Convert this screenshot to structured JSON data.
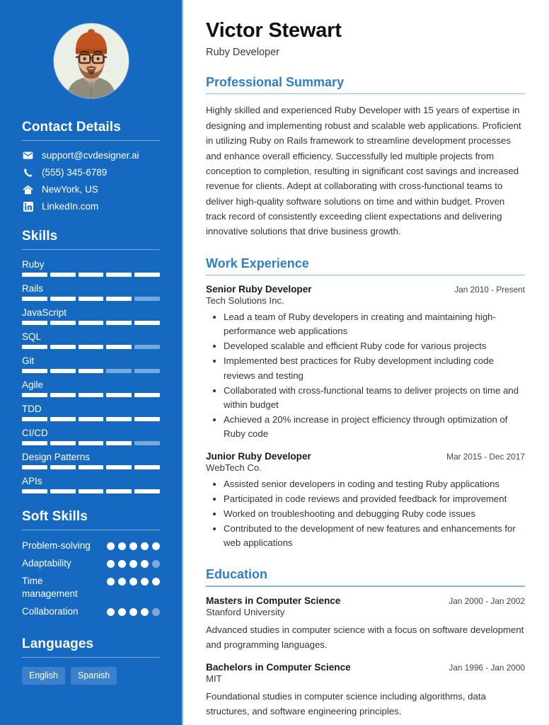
{
  "colors": {
    "sidebar_bg": "#1669c0",
    "accent": "#2f7fc4",
    "rule": "#87b6dd",
    "skill_off": "#76a7dd",
    "dot_off": "#7fa9d6",
    "badge_bg": "#3a80cb"
  },
  "sidebar": {
    "avatar": {
      "icon": "profile-photo",
      "alt": "Portrait of a man with an orange beanie, glasses and a beard"
    },
    "contact": {
      "heading": "Contact Details",
      "items": [
        {
          "icon": "envelope-icon",
          "label": "support@cvdesigner.ai"
        },
        {
          "icon": "phone-icon",
          "label": "(555) 345-6789"
        },
        {
          "icon": "home-icon",
          "label": "NewYork, US"
        },
        {
          "icon": "linkedin-icon",
          "label": "LinkedIn.com"
        }
      ]
    },
    "skills": {
      "heading": "Skills",
      "segments": 5,
      "items": [
        {
          "name": "Ruby",
          "filled": 5
        },
        {
          "name": "Rails",
          "filled": 4
        },
        {
          "name": "JavaScript",
          "filled": 5
        },
        {
          "name": "SQL",
          "filled": 4
        },
        {
          "name": "Git",
          "filled": 3
        },
        {
          "name": "Agile",
          "filled": 5
        },
        {
          "name": "TDD",
          "filled": 5
        },
        {
          "name": "CI/CD",
          "filled": 4
        },
        {
          "name": "Design Patterns",
          "filled": 5
        },
        {
          "name": "APIs",
          "filled": 5
        }
      ]
    },
    "soft_skills": {
      "heading": "Soft Skills",
      "dots_total": 5,
      "items": [
        {
          "name": "Problem-solving",
          "filled": 5
        },
        {
          "name": "Adaptability",
          "filled": 4
        },
        {
          "name": "Time management",
          "filled": 5
        },
        {
          "name": "Collaboration",
          "filled": 4
        }
      ]
    },
    "languages": {
      "heading": "Languages",
      "items": [
        "English",
        "Spanish"
      ]
    }
  },
  "main": {
    "name": "Victor Stewart",
    "job_title": "Ruby Developer",
    "summary": {
      "heading": "Professional Summary",
      "text": "Highly skilled and experienced Ruby Developer with 15 years of expertise in designing and implementing robust and scalable web applications. Proficient in utilizing Ruby on Rails framework to streamline development processes and enhance overall efficiency. Successfully led multiple projects from conception to completion, resulting in significant cost savings and increased revenue for clients. Adept at collaborating with cross-functional teams to deliver high-quality software solutions on time and within budget. Proven track record of consistently exceeding client expectations and delivering innovative solutions that drive business growth."
    },
    "experience": {
      "heading": "Work Experience",
      "entries": [
        {
          "title": "Senior Ruby Developer",
          "date": "Jan 2010 - Present",
          "org": "Tech Solutions Inc.",
          "bullets": [
            "Lead a team of Ruby developers in creating and maintaining high-performance web applications",
            "Developed scalable and efficient Ruby code for various projects",
            "Implemented best practices for Ruby development including code reviews and testing",
            "Collaborated with cross-functional teams to deliver projects on time and within budget",
            "Achieved a 20% increase in project efficiency through optimization of Ruby code"
          ]
        },
        {
          "title": "Junior Ruby Developer",
          "date": "Mar 2015 - Dec 2017",
          "org": "WebTech Co.",
          "bullets": [
            "Assisted senior developers in coding and testing Ruby applications",
            "Participated in code reviews and provided feedback for improvement",
            "Worked on troubleshooting and debugging Ruby code issues",
            "Contributed to the development of new features and enhancements for web applications"
          ]
        }
      ]
    },
    "education": {
      "heading": "Education",
      "entries": [
        {
          "title": "Masters in Computer Science",
          "date": "Jan 2000 - Jan 2002",
          "org": "Stanford University",
          "description": "Advanced studies in computer science with a focus on software development and programming languages."
        },
        {
          "title": "Bachelors in Computer Science",
          "date": "Jan 1996 - Jan 2000",
          "org": "MIT",
          "description": "Foundational studies in computer science including algorithms, data structures, and software engineering principles."
        }
      ]
    }
  }
}
